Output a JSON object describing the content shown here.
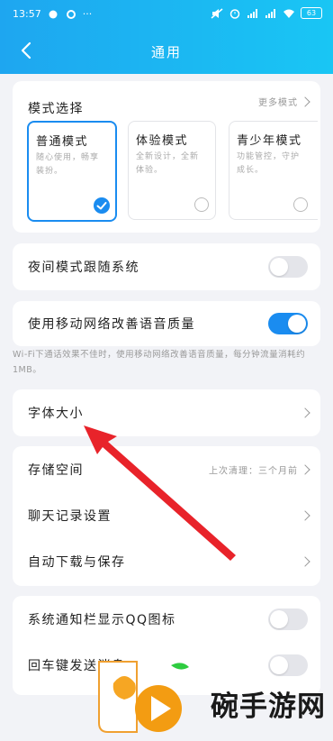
{
  "status_bar": {
    "time": "13:57",
    "dots": "···",
    "battery": "63"
  },
  "header": {
    "title": "通用"
  },
  "mode_section": {
    "title": "模式选择",
    "more": "更多模式",
    "modes": [
      {
        "name": "普通模式",
        "desc": "随心使用，畅享装扮。",
        "selected": true
      },
      {
        "name": "体验模式",
        "desc": "全新设计，全新体验。",
        "selected": false
      },
      {
        "name": "青少年模式",
        "desc": "功能管控，守护成长。",
        "selected": false
      }
    ]
  },
  "night_mode": {
    "label": "夜间模式跟随系统",
    "on": false
  },
  "mobile_voice": {
    "label": "使用移动网络改善语音质量",
    "on": true
  },
  "hint": "Wi-Fi下通话效果不佳时，使用移动网络改善语音质量，每分钟流量消耗约1MB。",
  "font_size": {
    "label": "字体大小"
  },
  "storage": {
    "label": "存储空间",
    "value": "上次清理：三个月前"
  },
  "chat_history": {
    "label": "聊天记录设置"
  },
  "auto_download": {
    "label": "自动下载与保存"
  },
  "notify_icon": {
    "label": "系统通知栏显示QQ图标",
    "on": false
  },
  "enter_send": {
    "label": "回车键发送消息",
    "on": false
  },
  "watermark": {
    "text": "碗手游网"
  },
  "colors": {
    "accent": "#1a8cf0",
    "header_start": "#1ea6f0",
    "header_end": "#19c6f4",
    "arrow": "#e8232a"
  }
}
